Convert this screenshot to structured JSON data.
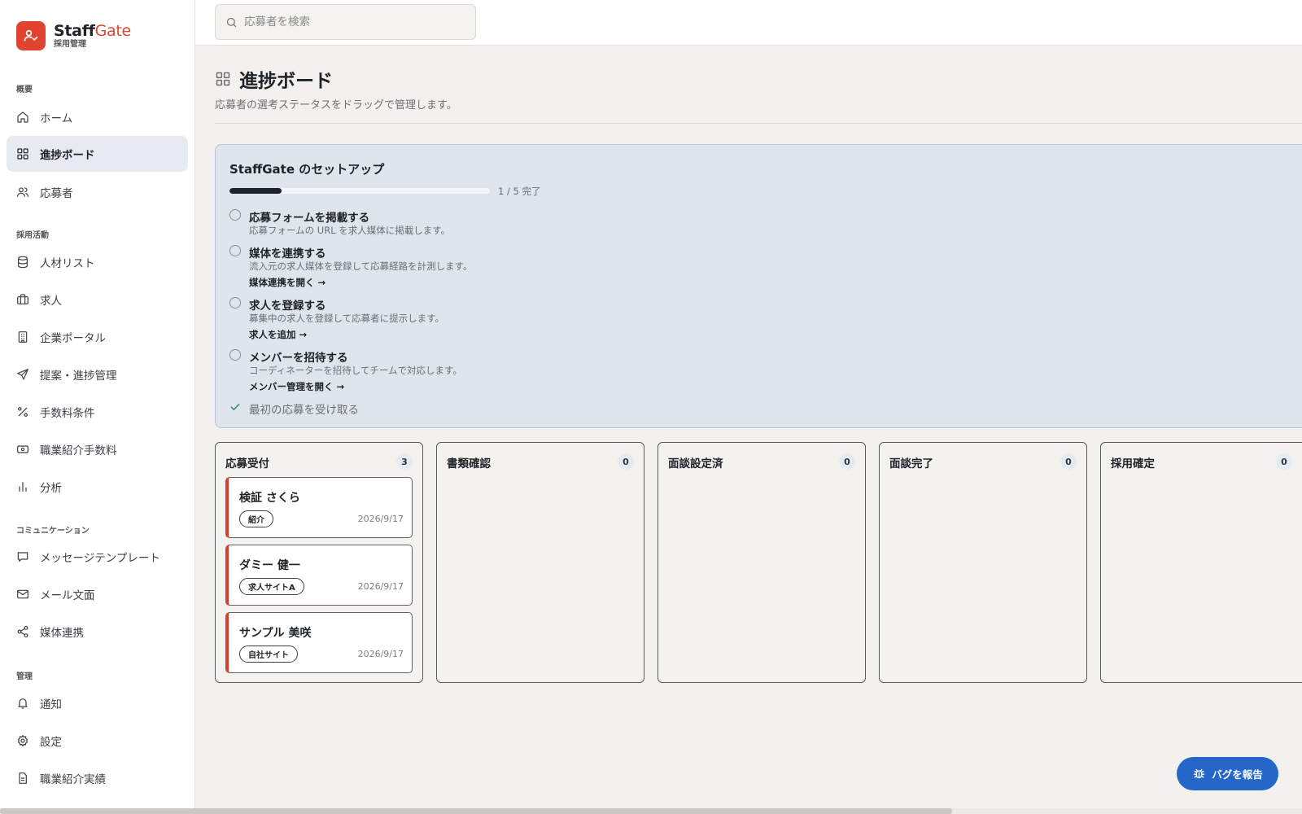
{
  "brand": {
    "name_part1": "Staff",
    "name_part2": "Gate",
    "subtitle": "採用管理"
  },
  "sidebar": {
    "sections": [
      {
        "label": "概要"
      },
      {
        "label": "採用活動"
      },
      {
        "label": "コミュニケーション"
      },
      {
        "label": "管理"
      }
    ],
    "items": [
      {
        "label": "ホーム",
        "icon": "home-icon"
      },
      {
        "label": "進捗ボード",
        "icon": "grid-icon",
        "active": true
      },
      {
        "label": "応募者",
        "icon": "users-icon"
      },
      {
        "label": "人材リスト",
        "icon": "database-icon"
      },
      {
        "label": "求人",
        "icon": "briefcase-icon"
      },
      {
        "label": "企業ポータル",
        "icon": "building-icon"
      },
      {
        "label": "提案・進捗管理",
        "icon": "send-icon"
      },
      {
        "label": "手数料条件",
        "icon": "percent-icon"
      },
      {
        "label": "職業紹介手数料",
        "icon": "banknote-icon"
      },
      {
        "label": "分析",
        "icon": "bar-chart-icon"
      },
      {
        "label": "メッセージテンプレート",
        "icon": "message-icon"
      },
      {
        "label": "メール文面",
        "icon": "mail-icon"
      },
      {
        "label": "媒体連携",
        "icon": "share-icon"
      },
      {
        "label": "通知",
        "icon": "bell-icon"
      },
      {
        "label": "設定",
        "icon": "gear-icon"
      },
      {
        "label": "職業紹介実績",
        "icon": "document-icon"
      }
    ]
  },
  "search": {
    "placeholder": "応募者を検索"
  },
  "page": {
    "title": "進捗ボード",
    "subtitle": "応募者の選考ステータスをドラッグで管理します。"
  },
  "setup": {
    "title": "StaffGate のセットアップ",
    "progress_text": "1 / 5 完了",
    "progress_fraction": 0.2,
    "steps": [
      {
        "title": "応募フォームを掲載する",
        "desc": "応募フォームの URL を求人媒体に掲載します。",
        "link": ""
      },
      {
        "title": "媒体を連携する",
        "desc": "流入元の求人媒体を登録して応募経路を計測します。",
        "link": "媒体連携を開く →"
      },
      {
        "title": "求人を登録する",
        "desc": "募集中の求人を登録して応募者に提示します。",
        "link": "求人を追加 →"
      },
      {
        "title": "メンバーを招待する",
        "desc": "コーディネーターを招待してチームで対応します。",
        "link": "メンバー管理を開く →"
      },
      {
        "title": "最初の応募を受け取る",
        "done": true
      }
    ]
  },
  "board": {
    "columns": [
      {
        "title": "応募受付",
        "count": "3",
        "cards": [
          {
            "name": "検証 さくら",
            "tag": "紹介",
            "date": "2026/9/17"
          },
          {
            "name": "ダミー 健一",
            "tag": "求人サイトA",
            "date": "2026/9/17"
          },
          {
            "name": "サンプル 美咲",
            "tag": "自社サイト",
            "date": "2026/9/17"
          }
        ]
      },
      {
        "title": "書類確認",
        "count": "0",
        "cards": []
      },
      {
        "title": "面談設定済",
        "count": "0",
        "cards": []
      },
      {
        "title": "面談完了",
        "count": "0",
        "cards": []
      },
      {
        "title": "採用確定",
        "count": "0",
        "cards": []
      }
    ]
  },
  "bug_button": {
    "label": "バグを報告",
    "icon": "bug-icon"
  },
  "colors": {
    "brand": "#e0442f",
    "accent_blue": "#2467c9",
    "active_nav": "#e7ebf1",
    "card_stripe": "#d7402c"
  }
}
